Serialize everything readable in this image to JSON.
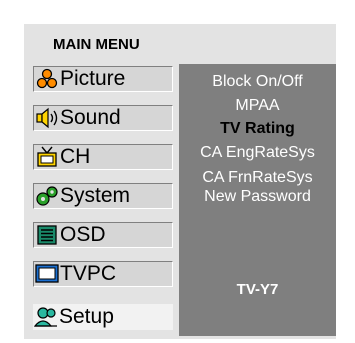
{
  "title": "MAIN MENU",
  "main_menu": {
    "items": [
      {
        "label": "Picture",
        "icon": "picture-icon"
      },
      {
        "label": "Sound",
        "icon": "speaker-icon"
      },
      {
        "label": "CH",
        "icon": "tv-antenna-icon"
      },
      {
        "label": "System",
        "icon": "gears-icon"
      },
      {
        "label": "OSD",
        "icon": "osd-list-icon"
      },
      {
        "label": "TVPC",
        "icon": "monitor-icon"
      },
      {
        "label": "Setup",
        "icon": "user-setup-icon",
        "selected": true
      }
    ]
  },
  "submenu": {
    "items": [
      {
        "label": "Block On/Off"
      },
      {
        "label": "MPAA"
      },
      {
        "label": "TV Rating",
        "active": true
      },
      {
        "label": "CA EngRateSys"
      },
      {
        "label": "CA FrnRateSys"
      },
      {
        "label": "New Password"
      }
    ],
    "current_rating": "TV-Y7"
  },
  "colors": {
    "panel_bg": "#e3e3e3",
    "submenu_bg": "#7f7f7f",
    "submenu_text": "#ffffff",
    "active_text": "#000000"
  }
}
